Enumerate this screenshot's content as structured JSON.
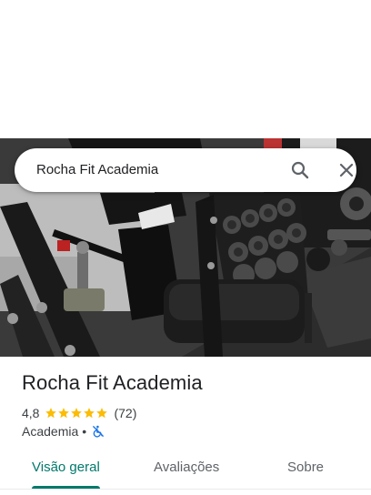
{
  "search": {
    "query": "Rocha Fit Academia"
  },
  "place": {
    "name": "Rocha Fit Academia",
    "rating": "4,8",
    "stars": 5,
    "review_count": "(72)",
    "category": "Academia",
    "separator": "•"
  },
  "tabs": [
    {
      "label": "Visão geral",
      "active": true
    },
    {
      "label": "Avaliações",
      "active": false
    },
    {
      "label": "Sobre",
      "active": false
    }
  ],
  "icons": {
    "search": "search-icon",
    "close": "close-icon",
    "star": "star-icon",
    "accessibility": "not-wheelchair-accessible-icon",
    "photo": "gym-equipment-photo"
  },
  "colors": {
    "accent": "#00796b",
    "star": "#fbbc04",
    "accessibility": "#1a73e8",
    "text": "#202124",
    "secondary_text": "#5f6368"
  }
}
